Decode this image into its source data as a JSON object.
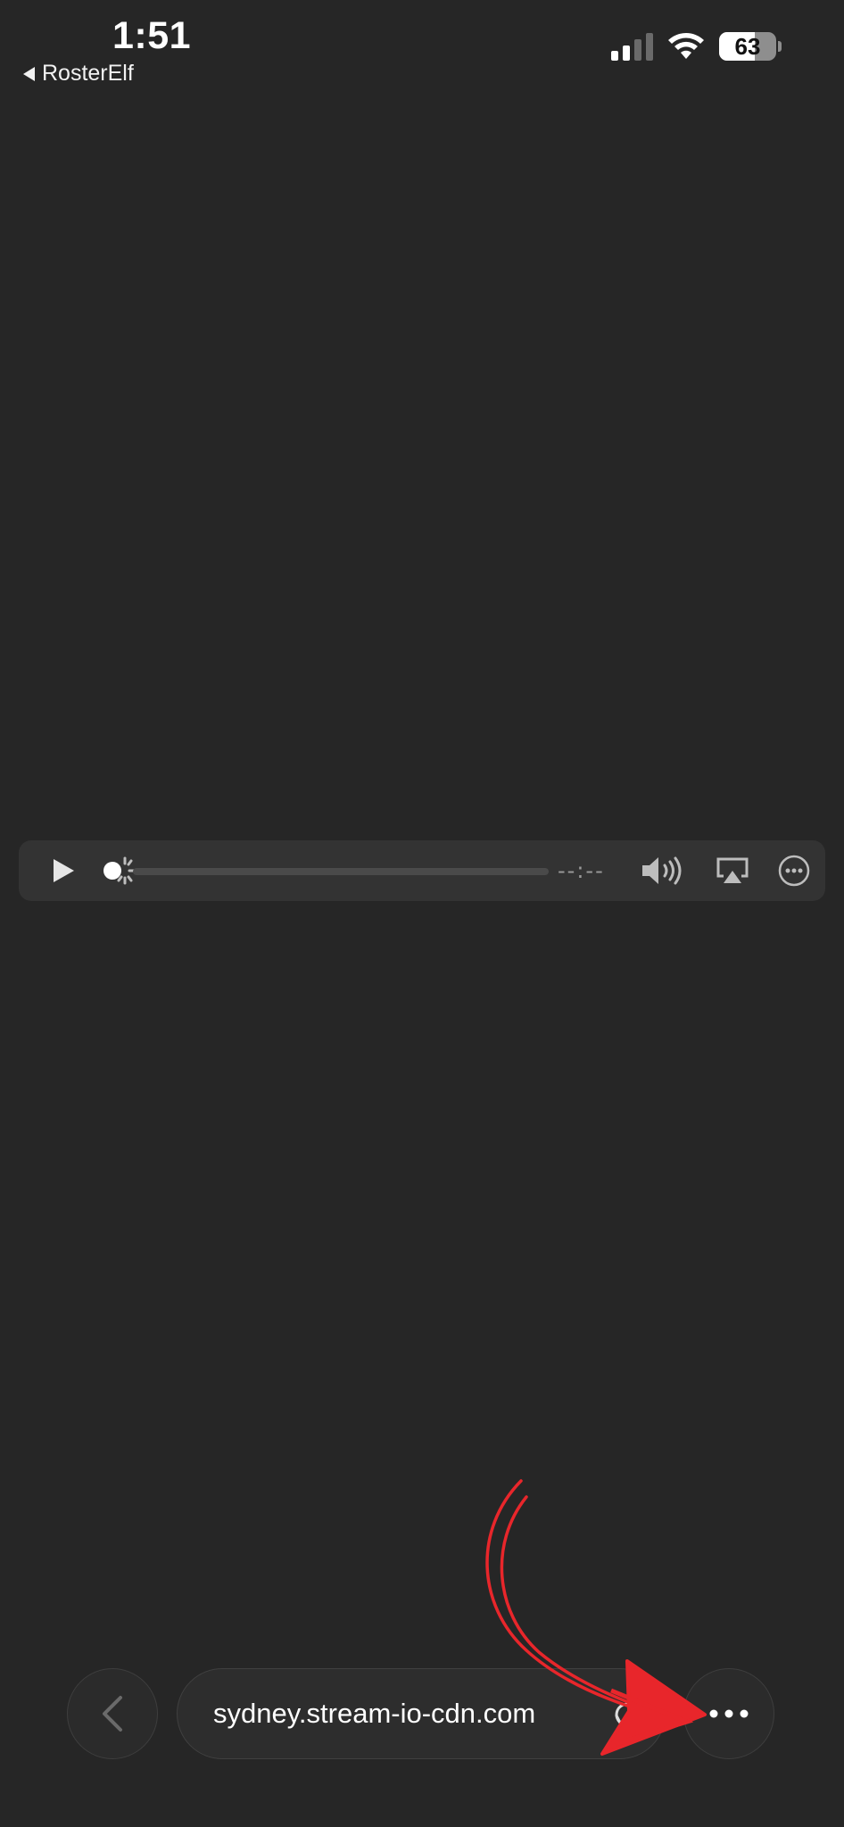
{
  "status_bar": {
    "time": "1:51",
    "back_app": "RosterElf",
    "battery_percent": "63",
    "battery_level": 0.63,
    "signal_bars_active": 2,
    "signal_bars_total": 4
  },
  "player": {
    "time_remaining": "--:--",
    "progress": 0,
    "icons": {
      "play": "play-icon",
      "loading": "loading-spinner-icon",
      "volume": "speaker-volume-icon",
      "airplay": "airplay-icon",
      "more": "more-options-icon"
    }
  },
  "browser_bar": {
    "url": "sydney.stream-io-cdn.com",
    "icons": {
      "back": "chevron-left-icon",
      "reload": "reload-icon",
      "menu": "ellipsis-icon"
    }
  },
  "annotation": {
    "color": "#e8262b",
    "icon": "red-arrow-annotation"
  }
}
